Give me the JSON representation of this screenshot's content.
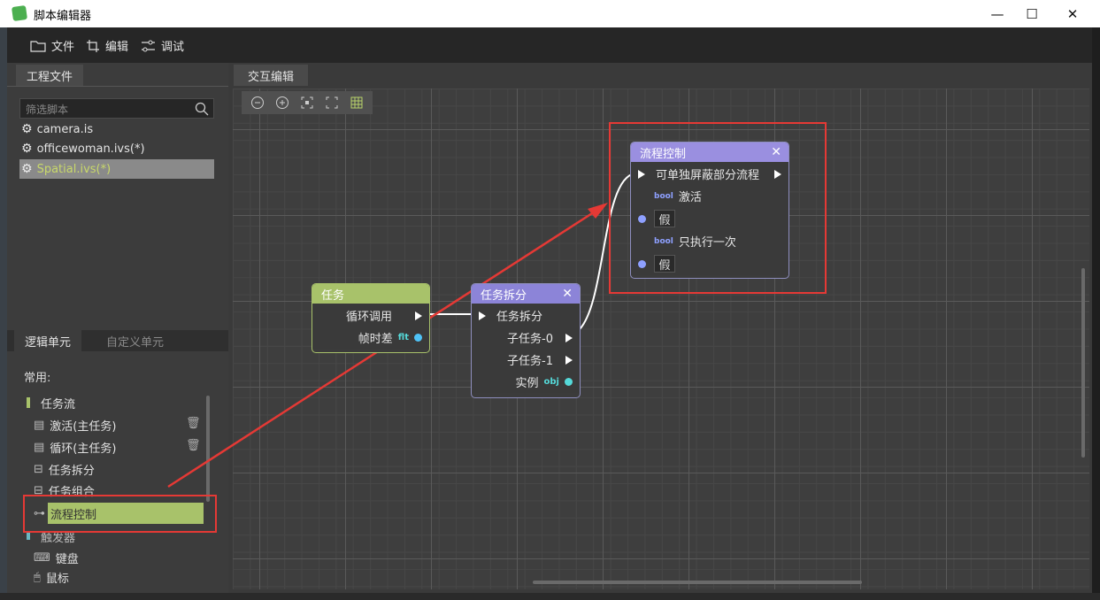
{
  "window": {
    "title": "脚本编辑器",
    "min": "—",
    "max": "☐",
    "close": "✕"
  },
  "menubar": {
    "file": "文件",
    "edit": "编辑",
    "debug": "调试"
  },
  "project": {
    "tab": "工程文件",
    "search_placeholder": "筛选脚本",
    "files": [
      {
        "name": "camera.is"
      },
      {
        "name": "officewoman.ivs(*)"
      },
      {
        "name": "Spatial.ivs(*)"
      }
    ]
  },
  "library": {
    "tab_logic": "逻辑单元",
    "tab_custom": "自定义单元",
    "section_common": "常用:",
    "group_taskflow": "任务流",
    "items": [
      {
        "label": "激活(主任务)"
      },
      {
        "label": "循环(主任务)"
      },
      {
        "label": "任务拆分"
      },
      {
        "label": "任务组合"
      },
      {
        "label": "流程控制"
      }
    ],
    "group_trigger": "触发器",
    "trigger_items": [
      {
        "label": "键盘"
      },
      {
        "label": "鼠标"
      }
    ]
  },
  "editor": {
    "tab": "交互编辑",
    "node_task": {
      "title": "任务",
      "out_loop": "循环调用",
      "out_delta": "帧时差",
      "delta_badge": "flt"
    },
    "node_split": {
      "title": "任务拆分",
      "in": "任务拆分",
      "out0": "子任务-0",
      "out1": "子任务-1",
      "instance": "实例",
      "instance_badge": "obj"
    },
    "node_flow": {
      "title": "流程控制",
      "in": "可单独屏蔽部分流程",
      "activate": "激活",
      "activate_val": "假",
      "once": "只执行一次",
      "once_val": "假",
      "bool_badge": "bool"
    }
  },
  "colors": {
    "task_head": "#a8c26a",
    "split_head": "#8c84d8",
    "flow_head": "#9a8fe0",
    "highlight": "#e53935",
    "selection": "#a8c26a"
  }
}
